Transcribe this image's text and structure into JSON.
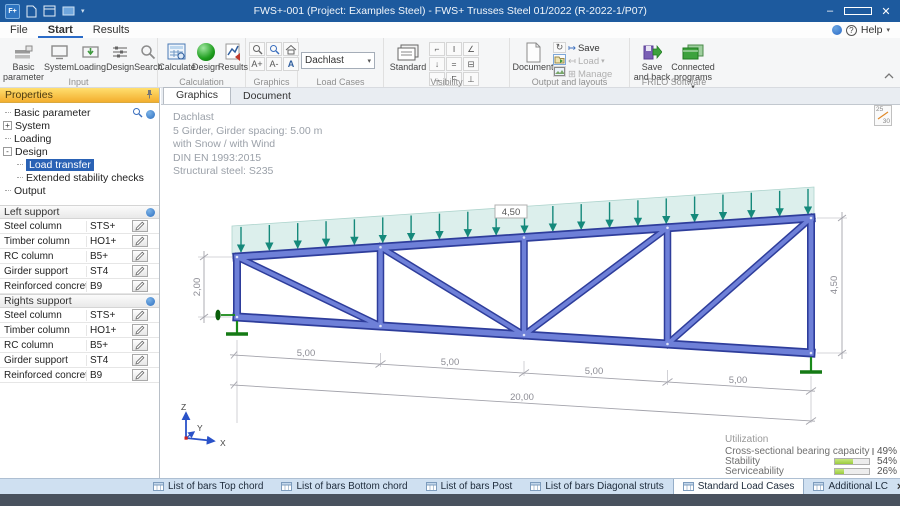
{
  "app": {
    "title": "FWS+-001 (Project: Examples Steel) - FWS+ Trusses Steel 01/2022 (R-2022-1/P07)",
    "help_label": "Help",
    "logo_text": "F+"
  },
  "icons": {
    "caret": "▾",
    "close_x": "✕",
    "close_small": "×",
    "minimize": "–",
    "help_q": "?",
    "sync": "↻",
    "save_arrow": "↦",
    "load_arrow": "↤",
    "manage_grid": "⊞"
  },
  "menu": {
    "file": "File",
    "start": "Start",
    "results": "Results"
  },
  "ribbon": {
    "group_labels": {
      "input": "Input",
      "calculation": "Calculation",
      "graphics": "Graphics",
      "load_cases": "Load Cases",
      "visibility": "Visibility",
      "output": "Output and layouts",
      "frilo": "FRILO Software"
    },
    "input_buttons": [
      {
        "label": "Basic parameter"
      },
      {
        "label": "System"
      },
      {
        "label": "Loading"
      },
      {
        "label": "Design"
      },
      {
        "label": "Search"
      }
    ],
    "calc_buttons": [
      {
        "label": "Calculate"
      },
      {
        "label": "Design"
      },
      {
        "label": "Results"
      }
    ],
    "graphics_buttons": [
      {
        "label": "A+"
      },
      {
        "label": "A-"
      },
      {
        "label": "A"
      }
    ],
    "load_case_selected": "Dachlast",
    "visibility": {
      "standard_label": "Standard",
      "toggles": [
        "⌐",
        "I",
        "∠",
        "↓",
        "=",
        "⊟",
        "↔",
        "F",
        "⊥"
      ]
    },
    "output": {
      "document_label": "Document",
      "save_label": "Save",
      "load_label": "Load",
      "manage_label": "Manage"
    },
    "frilo": {
      "save_back_label": "Save and back",
      "connected_label": "Connected programs"
    }
  },
  "properties": {
    "header": "Properties",
    "expanders": {
      "system": "+",
      "design": "-"
    },
    "tree": {
      "basic": "Basic parameter",
      "system": "System",
      "loading": "Loading",
      "design": "Design",
      "load_transfer": "Load transfer",
      "extended": "Extended stability checks",
      "output": "Output"
    }
  },
  "supports": {
    "left_header": "Left support",
    "right_header": "Rights support",
    "rows": [
      {
        "label": "Steel column",
        "value": "STS+"
      },
      {
        "label": "Timber column",
        "value": "HO1+"
      },
      {
        "label": "RC column",
        "value": "B5+"
      },
      {
        "label": "Girder support",
        "value": "ST4"
      },
      {
        "label": "Reinforced concrete corbel",
        "value": "B9"
      }
    ]
  },
  "main": {
    "tabs": {
      "graphics": "Graphics",
      "document": "Document"
    },
    "info_lines": {
      "l1": "Dachlast",
      "l2": "5 Girder, Girder spacing: 5.00 m",
      "l3": "with Snow / with Wind",
      "l4": "DIN EN 1993:2015",
      "l5": "Structural steel: S235"
    },
    "scale_badge": {
      "top": "25",
      "bottom": "30"
    },
    "drawing": {
      "load_label": "4,50",
      "dim_left_height": "2,00",
      "dim_right_height": "4,50",
      "dim_panel": "5,00",
      "dim_total": "20,00",
      "axis_x": "X",
      "axis_y": "Y",
      "axis_z": "Z"
    },
    "utilization": {
      "title": "Utilization",
      "rows": [
        {
          "label": "Cross-sectional bearing capacity",
          "percent": 49,
          "text": "49%"
        },
        {
          "label": "Stability",
          "percent": 54,
          "text": "54%"
        },
        {
          "label": "Serviceability",
          "percent": 26,
          "text": "26%"
        }
      ]
    }
  },
  "bottom_tabs": {
    "active_index": 4,
    "items": [
      {
        "label": "List of bars Top chord"
      },
      {
        "label": "List of bars Bottom chord"
      },
      {
        "label": "List of bars Post"
      },
      {
        "label": "List of bars Diagonal struts"
      },
      {
        "label": "Standard Load Cases"
      },
      {
        "label": "Additional LC"
      }
    ]
  },
  "colors": {
    "titlebar": "#1d5a9e",
    "selection": "#2a62b5",
    "member_fill": "#6a7cd6",
    "member_edge": "#2e3d9b",
    "load_teal": "#15897b",
    "support_green": "#1a8a1a",
    "util_bar": "#9ccb3f"
  }
}
